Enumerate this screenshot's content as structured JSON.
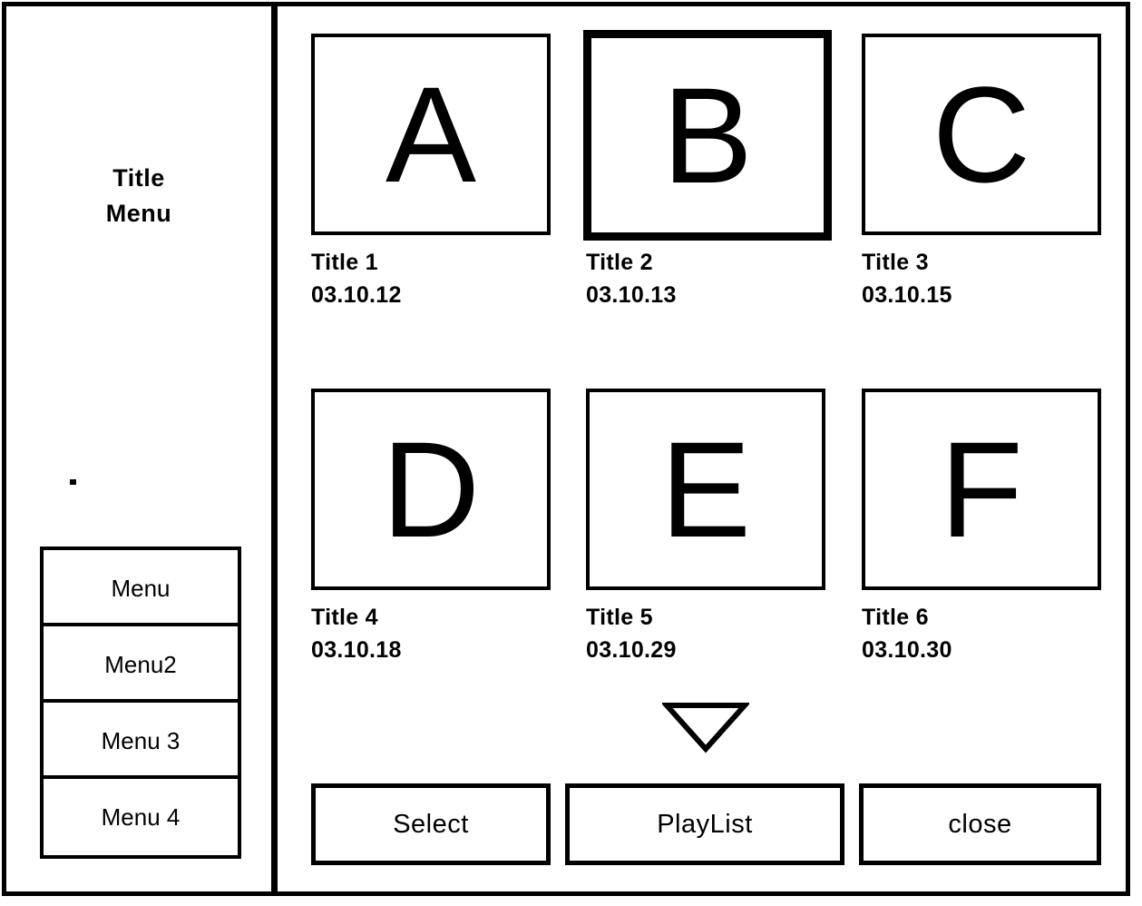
{
  "sidebar": {
    "title_line1": "Title",
    "title_line2": "Menu",
    "menu_items": [
      {
        "label": "Menu"
      },
      {
        "label": "Menu2"
      },
      {
        "label": "Menu 3"
      },
      {
        "label": "Menu 4"
      }
    ]
  },
  "content": {
    "thumbnails": [
      {
        "letter": "A",
        "title": "Title 1",
        "date": "03.10.12",
        "selected": false
      },
      {
        "letter": "B",
        "title": "Title 2",
        "date": "03.10.13",
        "selected": true
      },
      {
        "letter": "C",
        "title": "Title 3",
        "date": "03.10.15",
        "selected": false
      },
      {
        "letter": "D",
        "title": "Title 4",
        "date": "03.10.18",
        "selected": false
      },
      {
        "letter": "E",
        "title": "Title 5",
        "date": "03.10.29",
        "selected": false
      },
      {
        "letter": "F",
        "title": "Title 6",
        "date": "03.10.30",
        "selected": false
      }
    ],
    "scroll_indicator": "scroll-down-triangle",
    "buttons": {
      "select_label": "Select",
      "playlist_label": "PlayList",
      "close_label": "close"
    }
  },
  "colors": {
    "ink": "#000000",
    "paper": "#ffffff"
  }
}
